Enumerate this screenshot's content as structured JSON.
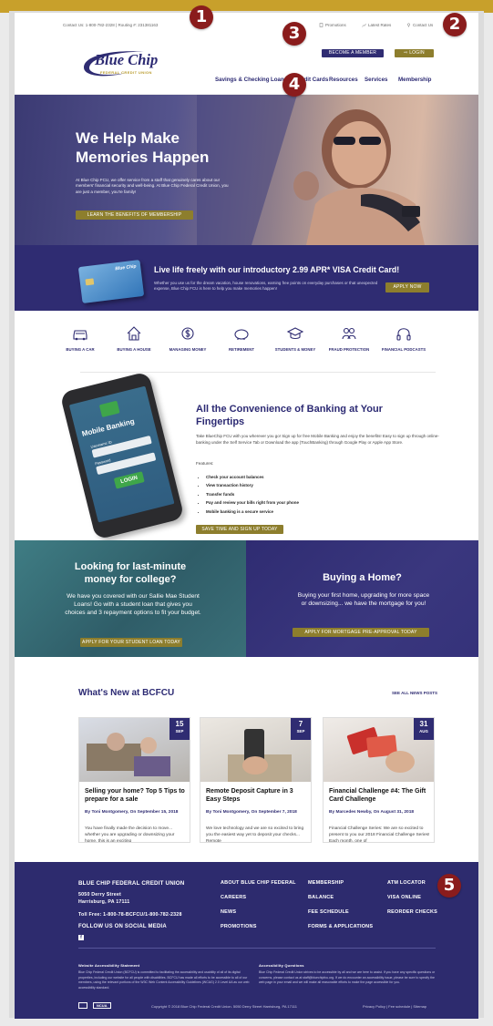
{
  "utility": {
    "contact": "Contact Us: 1-800-782-2328  |  Routing #: 231381163",
    "links": [
      "Promotions",
      "Latest Rates",
      "Contact Us"
    ]
  },
  "header": {
    "logo_text": "Blue Chip",
    "logo_sub": "FEDERAL CREDIT UNION",
    "member_button": "BECOME A MEMBER",
    "login_button": "⇨ LOGIN",
    "nav": [
      "Savings & Checking",
      "Loans & Credit Cards",
      "Resources",
      "Services",
      "Membership"
    ]
  },
  "hero": {
    "title": "We Help Make Memories Happen",
    "body": "At Blue Chip FCU, we offer service from a staff that genuinely cares about our members' financial security and well-being. At Blue Chip Federal Credit Union, you are just a member, you're family!",
    "button": "LEARN THE BENEFITS OF MEMBERSHIP"
  },
  "promo": {
    "card_brand": "Blue Chip",
    "title": "Live life freely with our introductory 2.99 APR* VISA Credit Card!",
    "body": "Whether you use us for the dream vacation, house renovations, earning free points on everyday purchases or that unexpected expense, Blue Chip FCU is here to help you make memories happen!",
    "button": "APPLY NOW"
  },
  "icons": [
    {
      "label": "BUYING A CAR",
      "icon": "car-icon"
    },
    {
      "label": "BUYING A HOUSE",
      "icon": "house-icon"
    },
    {
      "label": "MANAGING MONEY",
      "icon": "money-icon"
    },
    {
      "label": "RETIREMENT",
      "icon": "piggy-bank-icon"
    },
    {
      "label": "STUDENTS & MONEY",
      "icon": "graduation-cap-icon"
    },
    {
      "label": "FRAUD PROTECTION",
      "icon": "people-icon"
    },
    {
      "label": "FINANCIAL PODCASTS",
      "icon": "headphones-icon"
    }
  ],
  "mobile": {
    "phone_title": "Mobile Banking",
    "phone_fields": [
      "Username ID",
      "Password"
    ],
    "phone_button": "LOGIN",
    "title": "All the Convenience of Banking at Your Fingertips",
    "body": "Take BlueChip FCU with you wherever you go! Sign up for free Mobile Banking and enjoy the benefits! Easy to sign up through online-banking under the Self Service Tab or Download the app (TouchBanking) through Google Play or Apple App Store.",
    "features_label": "Features:",
    "features": [
      "Check your account balances",
      "View transaction history",
      "Transfer funds",
      "Pay and review your bills right from your phone",
      "Mobile banking is a secure service"
    ],
    "button": "SAVE TIME AND SIGN UP TODAY"
  },
  "college": {
    "title": "Looking for last-minute money for college?",
    "body": "We have you covered with our Sallie Mae Student Loans! Go with a student loan that gives you choices and 3 repayment options to fit your budget.",
    "button": "APPLY FOR YOUR STUDENT LOAN TODAY"
  },
  "home": {
    "title": "Buying a Home?",
    "body": "Buying your first home, upgrading for more space or downsizing... we have the mortgage for you!",
    "button": "APPLY FOR MORTGAGE PRE-APPROVAL TODAY"
  },
  "news": {
    "title": "What's New at BCFCU",
    "see_all": "SEE ALL NEWS POSTS",
    "cards": [
      {
        "day": "15",
        "month": "SEP",
        "title": "Selling your home? Top 5 Tips to prepare for a sale",
        "byline": "By Toni Montgomery, On September 15, 2018",
        "excerpt": "You have finally made the decision to move... whether you are upgrading or downsizing your home, this is an exciting"
      },
      {
        "day": "7",
        "month": "SEP",
        "title": "Remote Deposit Capture in 3 Easy Steps",
        "byline": "By Toni Montgomery, On September 7, 2018",
        "excerpt": "We love technology and we are so excited to bring you the easiest way yet to deposit your checks... Remote"
      },
      {
        "day": "31",
        "month": "AUG",
        "title": "Financial Challenge #4: The Gift Card Challenge",
        "byline": "By Marcedes Newby, On August 31, 2018",
        "excerpt": "Financial Challenge Series: We are so excited to present to you our 2018 Financial Challenge Series! Each month, one of"
      }
    ]
  },
  "footer": {
    "org": "BLUE CHIP FEDERAL CREDIT UNION",
    "address1": "5050 Derry Street",
    "address2": "Harrisburg, PA 17111",
    "phone": "Toll Free: 1-800-78-BCFCU/1-800-782-2328",
    "social": "FOLLOW US ON SOCIAL MEDIA",
    "col1": [
      "ABOUT BLUE CHIP FEDERAL",
      "CAREERS",
      "NEWS",
      "PROMOTIONS"
    ],
    "col2": [
      "MEMBERSHIP",
      "BALANCE",
      "FEE SCHEDULE",
      "FORMS & APPLICATIONS"
    ],
    "col3": [
      "ATM LOCATOR",
      "VISA ONLINE",
      "REORDER CHECKS"
    ],
    "access_title": "Website Accessibility Statement",
    "access_body": "Blue Chip Federal Credit Union (BCFCU) is committed to facilitating the accessibility and usability of all of its digital properties, including our website for all people with disabilities. BCFCU has made all efforts to be accessible to all of our members, using the relevant portions of the W3C Web Content Accessibility Guidelines (WCAG) 2.0 Level AA as our web accessibility standard.",
    "questions_title": "Accessibility Questions",
    "questions_body": "Blue Chip Federal Credit Union strives to be accessible by all and we are here to assist. If you have any specific questions or concerns, please contact us at staff@bluechipfcu.org. If we do encounter an accessibility issue, please be sure to specify the web page in your email and we will make all reasonable efforts to make the page accessible for you.",
    "ncua": "NCUA",
    "copyright": "Copyright © 2018 Blue Chip Federal Credit Union. 5050 Derry Street Harrisburg, PA 17111",
    "legal": "Privacy Policy | Fee schedule | Sitemap"
  },
  "markers": [
    "1",
    "2",
    "3",
    "4",
    "5"
  ],
  "colors": {
    "navy": "#2f2c72",
    "gold": "#8d7e2d",
    "marker": "#8a1c1c",
    "teal": "#3a6f78"
  }
}
